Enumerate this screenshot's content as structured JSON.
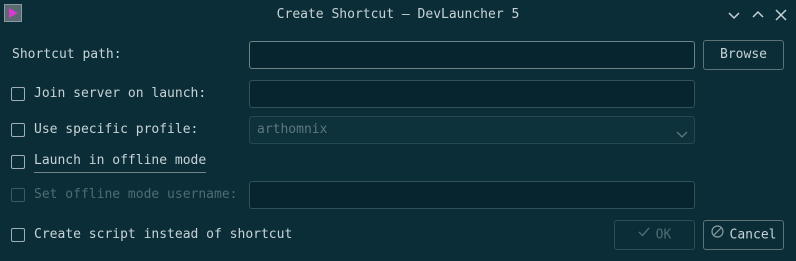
{
  "window": {
    "title": "Create Shortcut — DevLauncher 5",
    "icon": "app-launch-icon",
    "controls": [
      "chevron-down-icon",
      "chevron-up-icon",
      "close-icon"
    ]
  },
  "form": {
    "shortcut_path_label": "Shortcut path:",
    "shortcut_path_value": "",
    "browse_label": "Browse",
    "join_server_label": "Join server on launch:",
    "join_server_value": "",
    "specific_profile_label": "Use specific profile:",
    "profile_selected": "arthomnix",
    "offline_mode_label": "Launch in offline mode",
    "offline_username_label": "Set offline mode username:",
    "offline_username_value": "",
    "create_script_label": "Create script instead of shortcut"
  },
  "buttons": {
    "ok_label": "OK",
    "cancel_label": "Cancel"
  },
  "colors": {
    "background": "#0b2d37",
    "field": "#06252e",
    "text": "#c7d3d6",
    "disabled_text": "#4f6c73",
    "icon_accent": "#d63ad1"
  }
}
